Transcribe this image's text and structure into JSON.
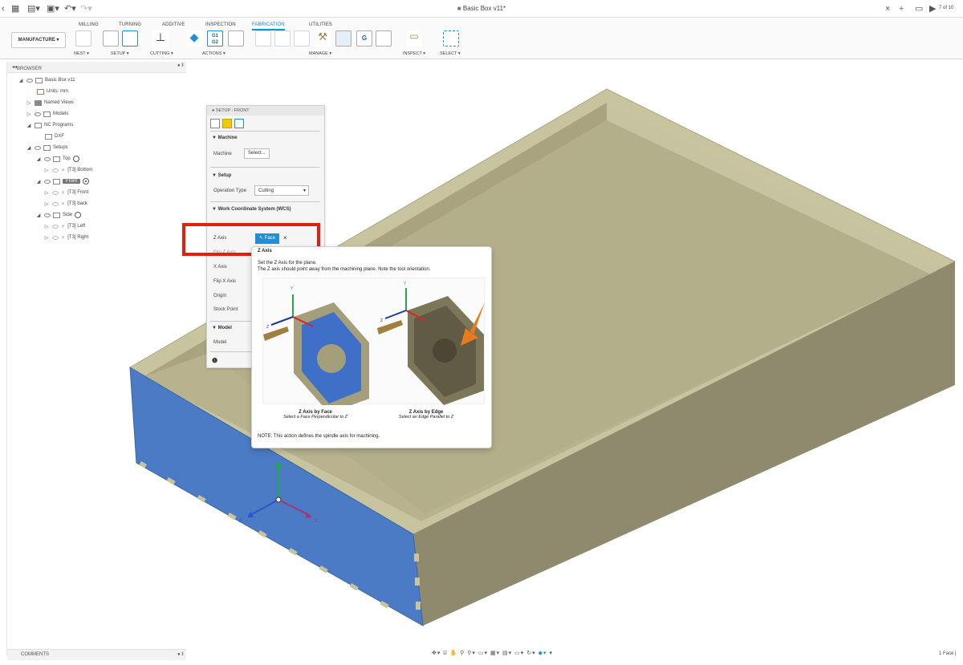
{
  "window": {
    "title": "Basic Box v11*",
    "page_counter": "7 of 10"
  },
  "ribbon": {
    "workspace": "MANUFACTURE",
    "tabs": [
      {
        "label": "MILLING"
      },
      {
        "label": "TURNING"
      },
      {
        "label": "ADDITIVE"
      },
      {
        "label": "INSPECTION"
      },
      {
        "label": "FABRICATION"
      },
      {
        "label": "UTILITIES"
      }
    ],
    "active_tab": "FABRICATION",
    "groups": {
      "nest": "NEST ▾",
      "setup": "SETUP ▾",
      "cutting": "CUTTING ▾",
      "actions": "ACTIONS ▾",
      "manage": "MANAGE ▾",
      "inspect": "INSPECT ▾",
      "select": "SELECT ▾"
    },
    "actions_icon_text": "G1\nG2"
  },
  "browser": {
    "title": "BROWSER",
    "items": [
      {
        "label": "Basic Box v11"
      },
      {
        "label": "Units: mm"
      },
      {
        "label": "Named Views"
      },
      {
        "label": "Models"
      },
      {
        "label": "NC Programs"
      },
      {
        "label": "DXF"
      },
      {
        "label": "Setups"
      },
      {
        "label": "Top"
      },
      {
        "label": "[T3] Bottom"
      },
      {
        "label": "Front"
      },
      {
        "label": "[T3] Front"
      },
      {
        "label": "[T3] back"
      },
      {
        "label": "Side"
      },
      {
        "label": "[T3] Left"
      },
      {
        "label": "[T3] Right"
      }
    ]
  },
  "setup_panel": {
    "title": "SETUP : FRONT",
    "machine_section": "▼ Machine",
    "machine_label": "Machine",
    "machine_button": "Select...",
    "setup_section": "▼ Setup",
    "operation_type_label": "Operation Type",
    "operation_type_value": "Cutting",
    "wcs_section": "▼ Work Coordinate System (WCS)",
    "z_axis_label": "Z Axis",
    "z_axis_button": "Face",
    "flip_z_label": "Flip Z Axis",
    "x_axis_label": "X Axis",
    "flip_x_label": "Flip X Axis",
    "origin_label": "Origin",
    "stock_point_label": "Stock Point",
    "model_section": "▼ Model",
    "model_label": "Model"
  },
  "tooltip": {
    "heading": "Z Axis",
    "line1": "Set the Z Axis for the plane.",
    "line2": "The Z axis should point away from the machining plane. Note the tool orientation.",
    "caption_left_title": "Z Axis by Face",
    "caption_left_sub": "Select a Face Perpendicular to Z",
    "caption_right_title": "Z Axis by Edge",
    "caption_right_sub": "Select an Edge Parallel to Z",
    "note": "NOTE: This action defines the spindle axis for machining.",
    "axis_y": "Y",
    "axis_z": "Z"
  },
  "viewport": {
    "axis_z": "Z",
    "axis_x": "X"
  },
  "comments": {
    "title": "COMMENTS"
  },
  "status": {
    "selection": "1 Face |"
  },
  "colors": {
    "accent": "#0696d7",
    "highlight": "#e02010",
    "face_selected": "#4a7bc4",
    "box_wood": "#b5b08a"
  }
}
